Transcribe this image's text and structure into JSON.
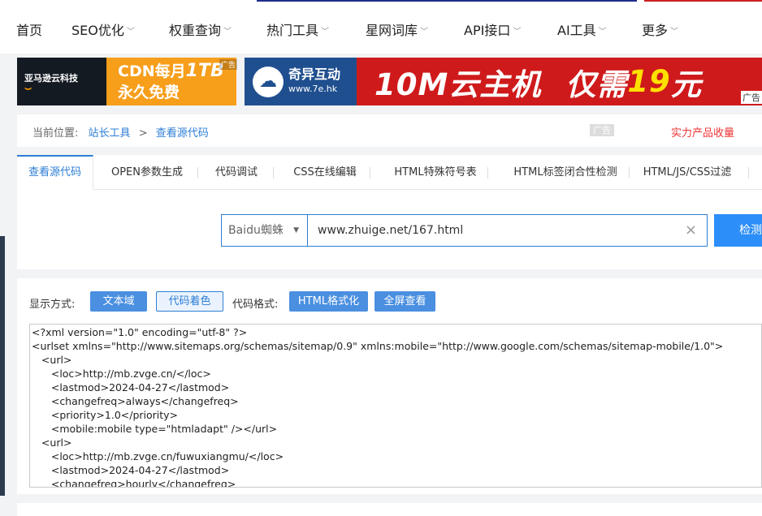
{
  "nav": {
    "items": [
      {
        "label": "首页",
        "has_caret": false
      },
      {
        "label": "SEO优化",
        "has_caret": true
      },
      {
        "label": "权重查询",
        "has_caret": true
      },
      {
        "label": "热门工具",
        "has_caret": true
      },
      {
        "label": "星网词库",
        "has_caret": true
      },
      {
        "label": "API接口",
        "has_caret": true
      },
      {
        "label": "AI工具",
        "has_caret": true
      },
      {
        "label": "更多",
        "has_caret": true
      }
    ],
    "caret": "﹀"
  },
  "ads": {
    "amazon": {
      "brand": "亚马逊云科技",
      "line1": "CDN每月",
      "highlight": "1TB",
      "line2": "永久免费",
      "badge": "广告"
    },
    "host7e": {
      "brand": "奇异互动",
      "domain": "www.7e.hk",
      "slogan_a": "10M云主机",
      "slogan_b": "仅需",
      "price": "19",
      "slogan_c": "元",
      "tag": "广告"
    }
  },
  "breadcrumb": {
    "prefix": "当前位置:",
    "items": [
      "站长工具",
      "查看源代码"
    ],
    "separator": ">",
    "ad_tag": "广告",
    "promo": "实力产品收量"
  },
  "tabs": [
    "查看源代码",
    "OPEN参数生成",
    "代码调试",
    "CSS在线编辑",
    "HTML特殊符号表",
    "HTML标签闭合性检测",
    "HTML/JS/CSS过滤"
  ],
  "search": {
    "engine": "Baidu蜘蛛",
    "url": "www.zhuige.net/167.html",
    "clear_icon": "×",
    "submit_label": "检测"
  },
  "display": {
    "mode_label": "显示方式:",
    "mode_options": [
      "文本域",
      "代码着色"
    ],
    "format_label": "代码格式:",
    "format_options": [
      "HTML格式化",
      "全屏查看"
    ]
  },
  "source_code": "<?xml version=\"1.0\" encoding=\"utf-8\" ?>\n<urlset xmlns=\"http://www.sitemaps.org/schemas/sitemap/0.9\" xmlns:mobile=\"http://www.google.com/schemas/sitemap-mobile/1.0\">\n   <url>\n      <loc>http://mb.zvge.cn/</loc>\n      <lastmod>2024-04-27</lastmod>\n      <changefreq>always</changefreq>\n      <priority>1.0</priority>\n      <mobile:mobile type=\"htmladapt\" /></url>\n   <url>\n      <loc>http://mb.zvge.cn/fuwuxiangmu/</loc>\n      <lastmod>2024-04-27</lastmod>\n      <changefreq>hourly</changefreq>",
  "colors": {
    "accent": "#2c7ed6",
    "button": "#4a8fe0",
    "promo": "#e33333",
    "ad_red": "#cf1a1b",
    "ad_orange": "#f79e1b"
  }
}
